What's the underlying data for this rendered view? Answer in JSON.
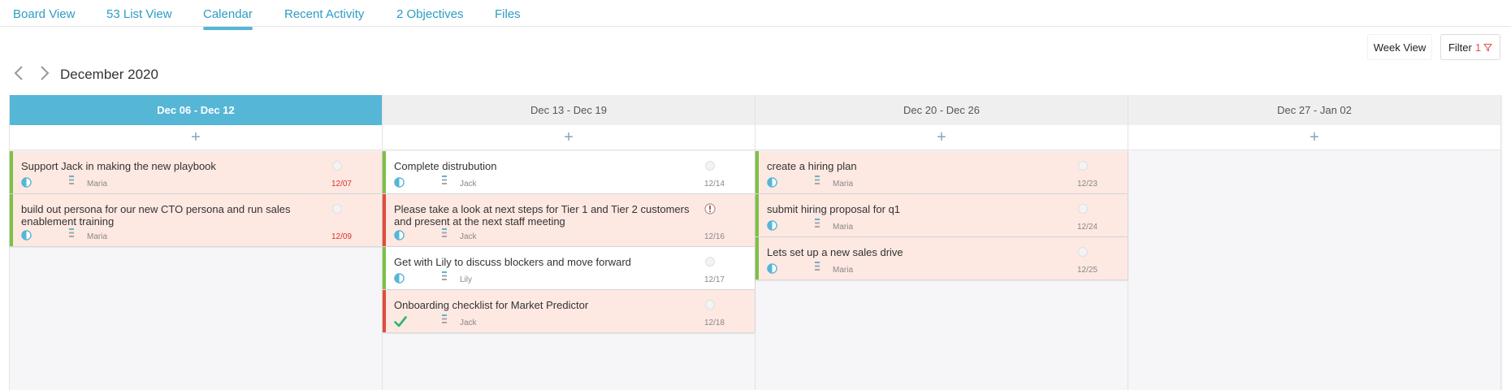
{
  "tabs": [
    {
      "label": "Board View",
      "active": false
    },
    {
      "label": "53 List View",
      "active": false
    },
    {
      "label": "Calendar",
      "active": true
    },
    {
      "label": "Recent Activity",
      "active": false
    },
    {
      "label": "2 Objectives",
      "active": false
    },
    {
      "label": "Files",
      "active": false
    }
  ],
  "toolbar": {
    "week_view_label": "Week View",
    "filter_label": "Filter",
    "filter_count": "1"
  },
  "month": {
    "title": "December 2020"
  },
  "colors": {
    "accent": "#56b6d6",
    "link": "#2c9dc4",
    "green_bar": "#7cc142",
    "red_bar": "#e14b3b",
    "overdue": "#d9342b",
    "card_pink": "#fde8e2"
  },
  "columns": [
    {
      "label": "Dec 06 - Dec 12",
      "add_label": "+",
      "cards": [
        {
          "title": "Support Jack in making the new playbook",
          "assignee": "Maria",
          "due": "12/07"
        },
        {
          "title": "build out persona for our new CTO persona and run sales enablement training",
          "assignee": "Maria",
          "due": "12/09"
        }
      ]
    },
    {
      "label": "Dec 13 - Dec 19",
      "add_label": "+",
      "cards": [
        {
          "title": "Complete distrubution",
          "assignee": "Jack",
          "due": "12/14"
        },
        {
          "title": "Please take a look at next steps for Tier 1 and Tier 2 customers and present at the next staff meeting",
          "assignee": "Jack",
          "due": "12/16"
        },
        {
          "title": "Get with Lily to discuss blockers and move forward",
          "assignee": "Lily",
          "due": "12/17"
        },
        {
          "title": "Onboarding checklist for Market Predictor",
          "assignee": "Jack",
          "due": "12/18"
        }
      ]
    },
    {
      "label": "Dec 20 - Dec 26",
      "add_label": "+",
      "cards": [
        {
          "title": "create a hiring plan",
          "assignee": "Maria",
          "due": "12/23"
        },
        {
          "title": "submit hiring proposal for q1",
          "assignee": "Maria",
          "due": "12/24"
        },
        {
          "title": "Lets set up a new sales drive",
          "assignee": "Maria",
          "due": "12/25"
        }
      ]
    },
    {
      "label": "Dec 27 - Jan 02",
      "add_label": "+",
      "cards": []
    }
  ]
}
